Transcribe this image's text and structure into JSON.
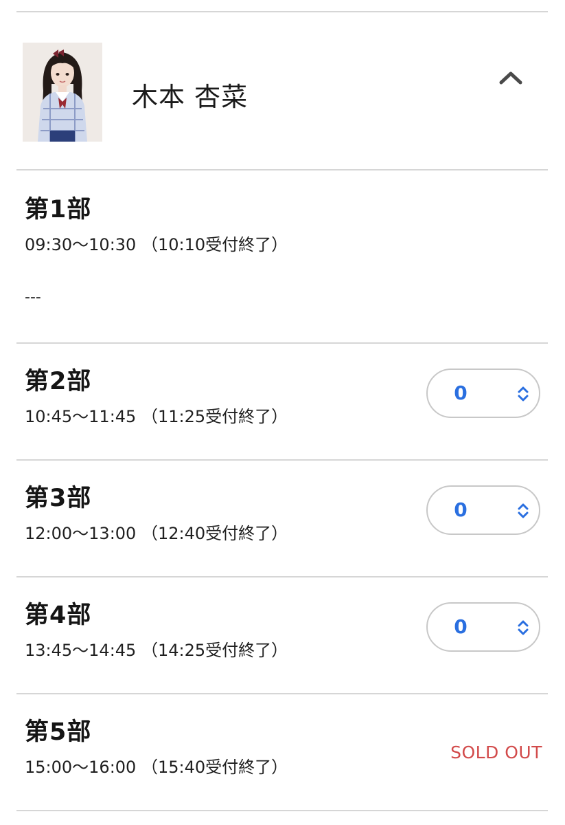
{
  "member": {
    "name": "木本 杏菜",
    "photo": "portrait-photo"
  },
  "colors": {
    "accent": "#2a6fe0",
    "sold_out": "#d24a4a",
    "divider": "#d6d6d6"
  },
  "sessions": [
    {
      "title": "第1部",
      "time": "09:30〜10:30 （10:10受付終了）",
      "status": "---"
    },
    {
      "title": "第2部",
      "time": "10:45〜11:45 （11:25受付終了）",
      "quantity": "0"
    },
    {
      "title": "第3部",
      "time": "12:00〜13:00 （12:40受付終了）",
      "quantity": "0"
    },
    {
      "title": "第4部",
      "time": "13:45〜14:45 （14:25受付終了）",
      "quantity": "0"
    },
    {
      "title": "第5部",
      "time": "15:00〜16:00 （15:40受付終了）",
      "status": "SOLD OUT"
    }
  ]
}
